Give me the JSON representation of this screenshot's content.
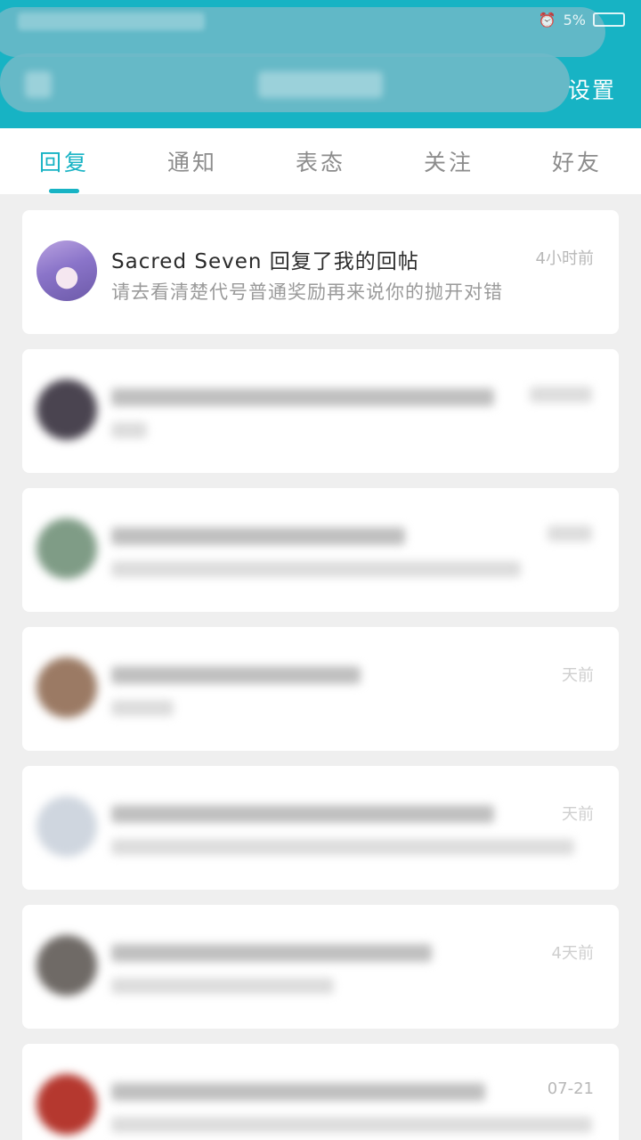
{
  "header": {
    "settings_label": "设置",
    "status": {
      "battery_text": "5%"
    }
  },
  "tabs": [
    {
      "label": "回复",
      "active": true
    },
    {
      "label": "通知",
      "active": false
    },
    {
      "label": "表态",
      "active": false
    },
    {
      "label": "关注",
      "active": false
    },
    {
      "label": "好友",
      "active": false
    }
  ],
  "messages": [
    {
      "title": "Sacred Seven 回复了我的回帖",
      "preview": "请去看清楚代号普通奖励再来说你的抛开对错",
      "time": "4小时前"
    },
    {
      "title": "",
      "preview": "",
      "time": "",
      "blurred": true
    },
    {
      "title": "",
      "preview": "",
      "time": "",
      "blurred": true
    },
    {
      "title": "",
      "preview": "",
      "time": "天前",
      "blurred": true
    },
    {
      "title": "",
      "preview": "",
      "time": "天前",
      "blurred": true
    },
    {
      "title": "",
      "preview": "",
      "time": "4天前",
      "blurred": true
    },
    {
      "title": "",
      "preview": "",
      "time": "07-21",
      "blurred": true
    }
  ],
  "colors": {
    "accent": "#17b3c4",
    "background": "#efefef"
  }
}
